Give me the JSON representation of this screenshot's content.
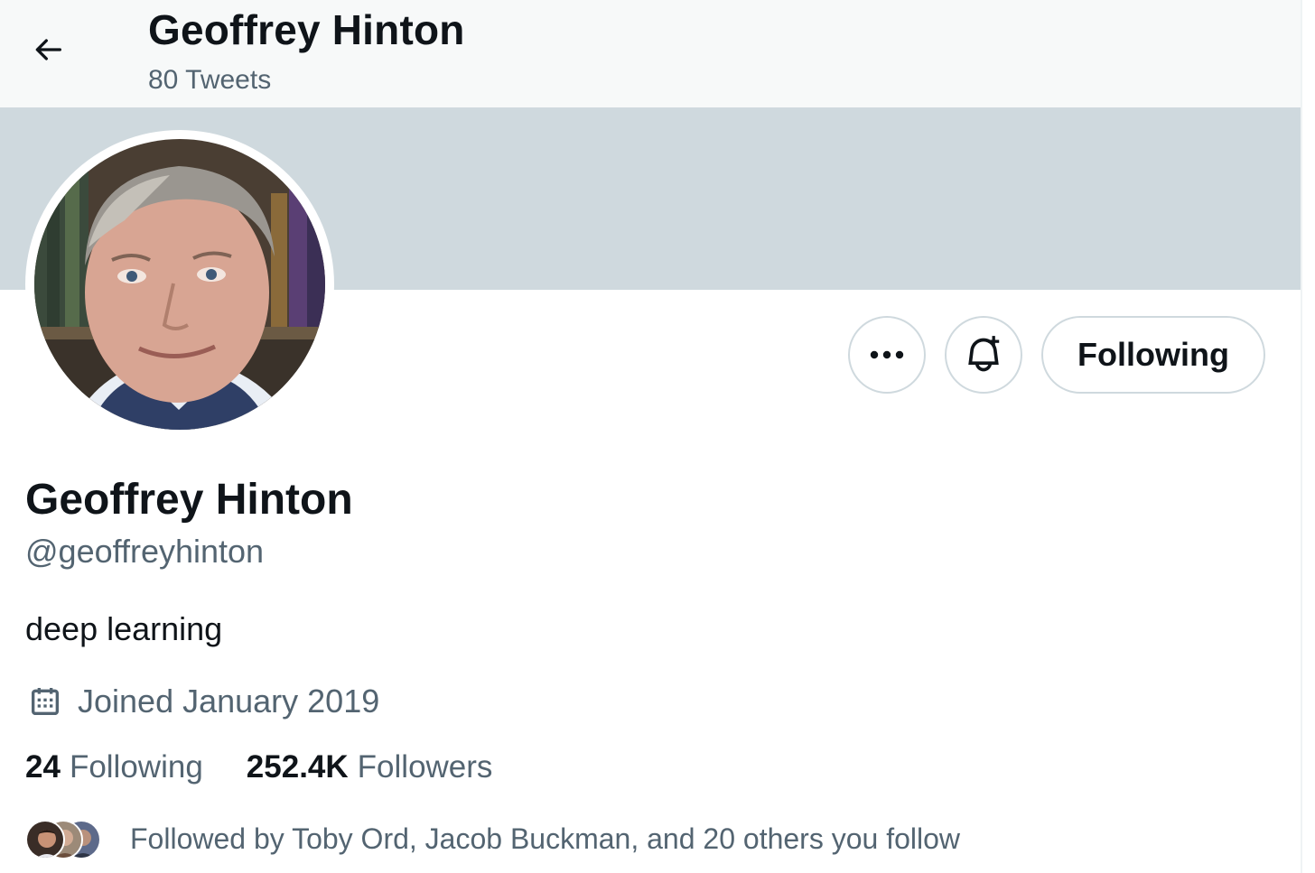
{
  "header": {
    "title": "Geoffrey Hinton",
    "subtitle": "80 Tweets",
    "back_icon": "arrow-left-icon"
  },
  "profile": {
    "display_name": "Geoffrey Hinton",
    "handle": "@geoffreyhinton",
    "bio": "deep learning",
    "joined": "Joined January 2019",
    "joined_icon": "calendar-icon"
  },
  "actions": {
    "more_icon": "more-dots-icon",
    "notify_icon": "bell-plus-icon",
    "follow_state_label": "Following"
  },
  "stats": {
    "following_count": "24",
    "following_label": "Following",
    "followers_count": "252.4K",
    "followers_label": "Followers"
  },
  "followed_by": {
    "text": "Followed by Toby Ord, Jacob Buckman, and 20 others you follow"
  },
  "colors": {
    "text_primary": "#0f1419",
    "text_secondary": "#536471",
    "banner": "#cfd9de",
    "border": "#cfd9de",
    "topbar": "#f7f9f9"
  }
}
